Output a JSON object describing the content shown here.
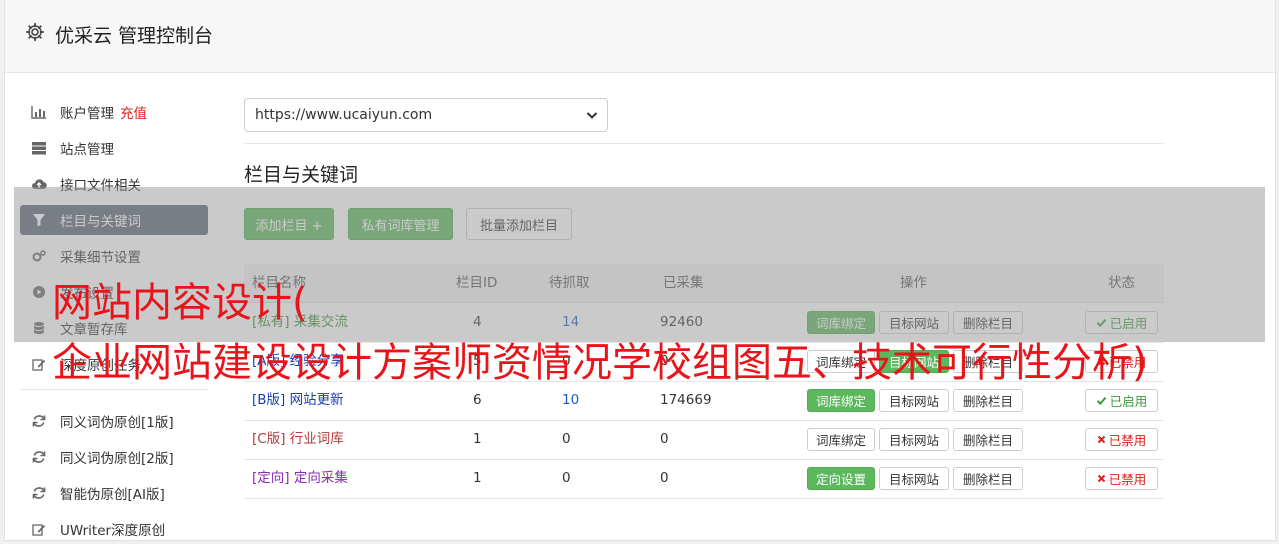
{
  "header": {
    "title": "优采云 管理控制台"
  },
  "sidebar": {
    "recharge_label": "充值",
    "items": [
      {
        "label": "账户管理",
        "icon": "bar-chart-icon"
      },
      {
        "label": "站点管理",
        "icon": "server-icon"
      },
      {
        "label": "接口文件相关",
        "icon": "cloud-upload-icon"
      },
      {
        "label": "栏目与关键词",
        "icon": "filter-icon",
        "active": true
      },
      {
        "label": "采集细节设置",
        "icon": "gears-icon"
      },
      {
        "label": "发布设置",
        "icon": "play-circle-icon"
      },
      {
        "label": "文章暂存库",
        "icon": "database-icon"
      },
      {
        "label": "深度原创任务",
        "icon": "edit-icon"
      },
      {
        "label": "同义词伪原创[1版]",
        "icon": "refresh-icon"
      },
      {
        "label": "同义词伪原创[2版]",
        "icon": "refresh-icon"
      },
      {
        "label": "智能伪原创[AI版]",
        "icon": "refresh-icon"
      },
      {
        "label": "UWriter深度原创",
        "icon": "edit-icon"
      }
    ]
  },
  "main": {
    "site_select": "https://www.ucaiyun.com",
    "section_title": "栏目与关键词",
    "buttons": {
      "add_column": "添加栏目 +",
      "private_lib": "私有词库管理",
      "batch_add": "批量添加栏目"
    },
    "table": {
      "headers": [
        "栏目名称",
        "栏目ID",
        "待抓取",
        "已采集",
        "操作",
        "状态"
      ],
      "rows": [
        {
          "tag": "[私有]",
          "name": "采集交流",
          "id": "4",
          "pending": "14",
          "collected": "92460",
          "action1": "词库绑定",
          "action2": "目标网站",
          "action3": "删除栏目",
          "status": "已启用",
          "on": true,
          "tag_color": "#3c8c3c",
          "action1_green": true
        },
        {
          "tag": "[A版]",
          "name": "经验分享",
          "id": "5",
          "pending": "0",
          "collected": "0",
          "action1": "词库绑定",
          "action2": "目标网站",
          "action3": "删除栏目",
          "status": "已禁用",
          "on": false,
          "tag_color": "#1a3fb4",
          "action1_green": false,
          "action2_green": true
        },
        {
          "tag": "[B版]",
          "name": "网站更新",
          "id": "6",
          "pending": "10",
          "collected": "174669",
          "action1": "词库绑定",
          "action2": "目标网站",
          "action3": "删除栏目",
          "status": "已启用",
          "on": true,
          "tag_color": "#1a3fb4",
          "action1_green": true
        },
        {
          "tag": "[C版]",
          "name": "行业词库",
          "id": "1",
          "pending": "0",
          "collected": "0",
          "action1": "词库绑定",
          "action2": "目标网站",
          "action3": "删除栏目",
          "status": "已禁用",
          "on": false,
          "tag_color": "#b43a3a",
          "action1_green": false
        },
        {
          "tag": "[定向]",
          "name": "定向采集",
          "id": "1",
          "pending": "0",
          "collected": "0",
          "action1": "定向设置",
          "action2": "目标网站",
          "action3": "删除栏目",
          "status": "已禁用",
          "on": false,
          "tag_color": "#8a2bb4",
          "action1_green": true
        }
      ]
    }
  },
  "overlay": {
    "line1": "网站内容设计(",
    "line2": "企业网站建设设计方案师资情况学校组图五、技术可行性分析)"
  },
  "colors": {
    "green": "#5cb85c",
    "red": "#d9231f",
    "sidebar_active": "#5c6674"
  }
}
